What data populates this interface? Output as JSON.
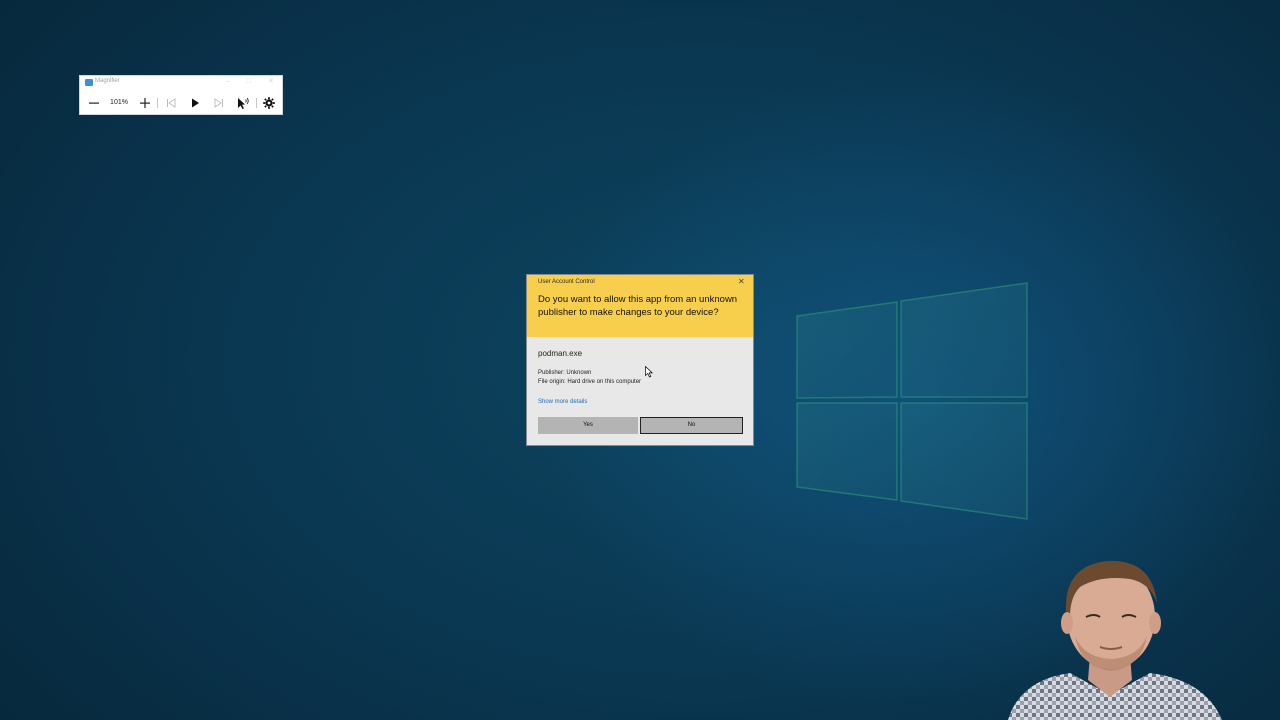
{
  "magnifier": {
    "title": "Magnifier",
    "zoom_level": "101%",
    "icons": {
      "zoom_out": "minus-icon",
      "zoom_in": "plus-icon",
      "previous": "skip-previous-icon",
      "play": "play-icon",
      "next": "skip-next-icon",
      "read_from_here": "read-from-here-icon",
      "settings": "gear-icon"
    }
  },
  "uac": {
    "title": "User Account Control",
    "question": "Do you want to allow this app from an unknown publisher to make changes to your device?",
    "app_name": "podman.exe",
    "publisher": "Publisher: Unknown",
    "file_origin": "File origin: Hard drive on this computer",
    "show_details": "Show more details",
    "yes_label": "Yes",
    "no_label": "No",
    "header_color": "#f8cf4c"
  },
  "colors": {
    "desktop": "#0a3650",
    "link": "#1a6fc0"
  }
}
